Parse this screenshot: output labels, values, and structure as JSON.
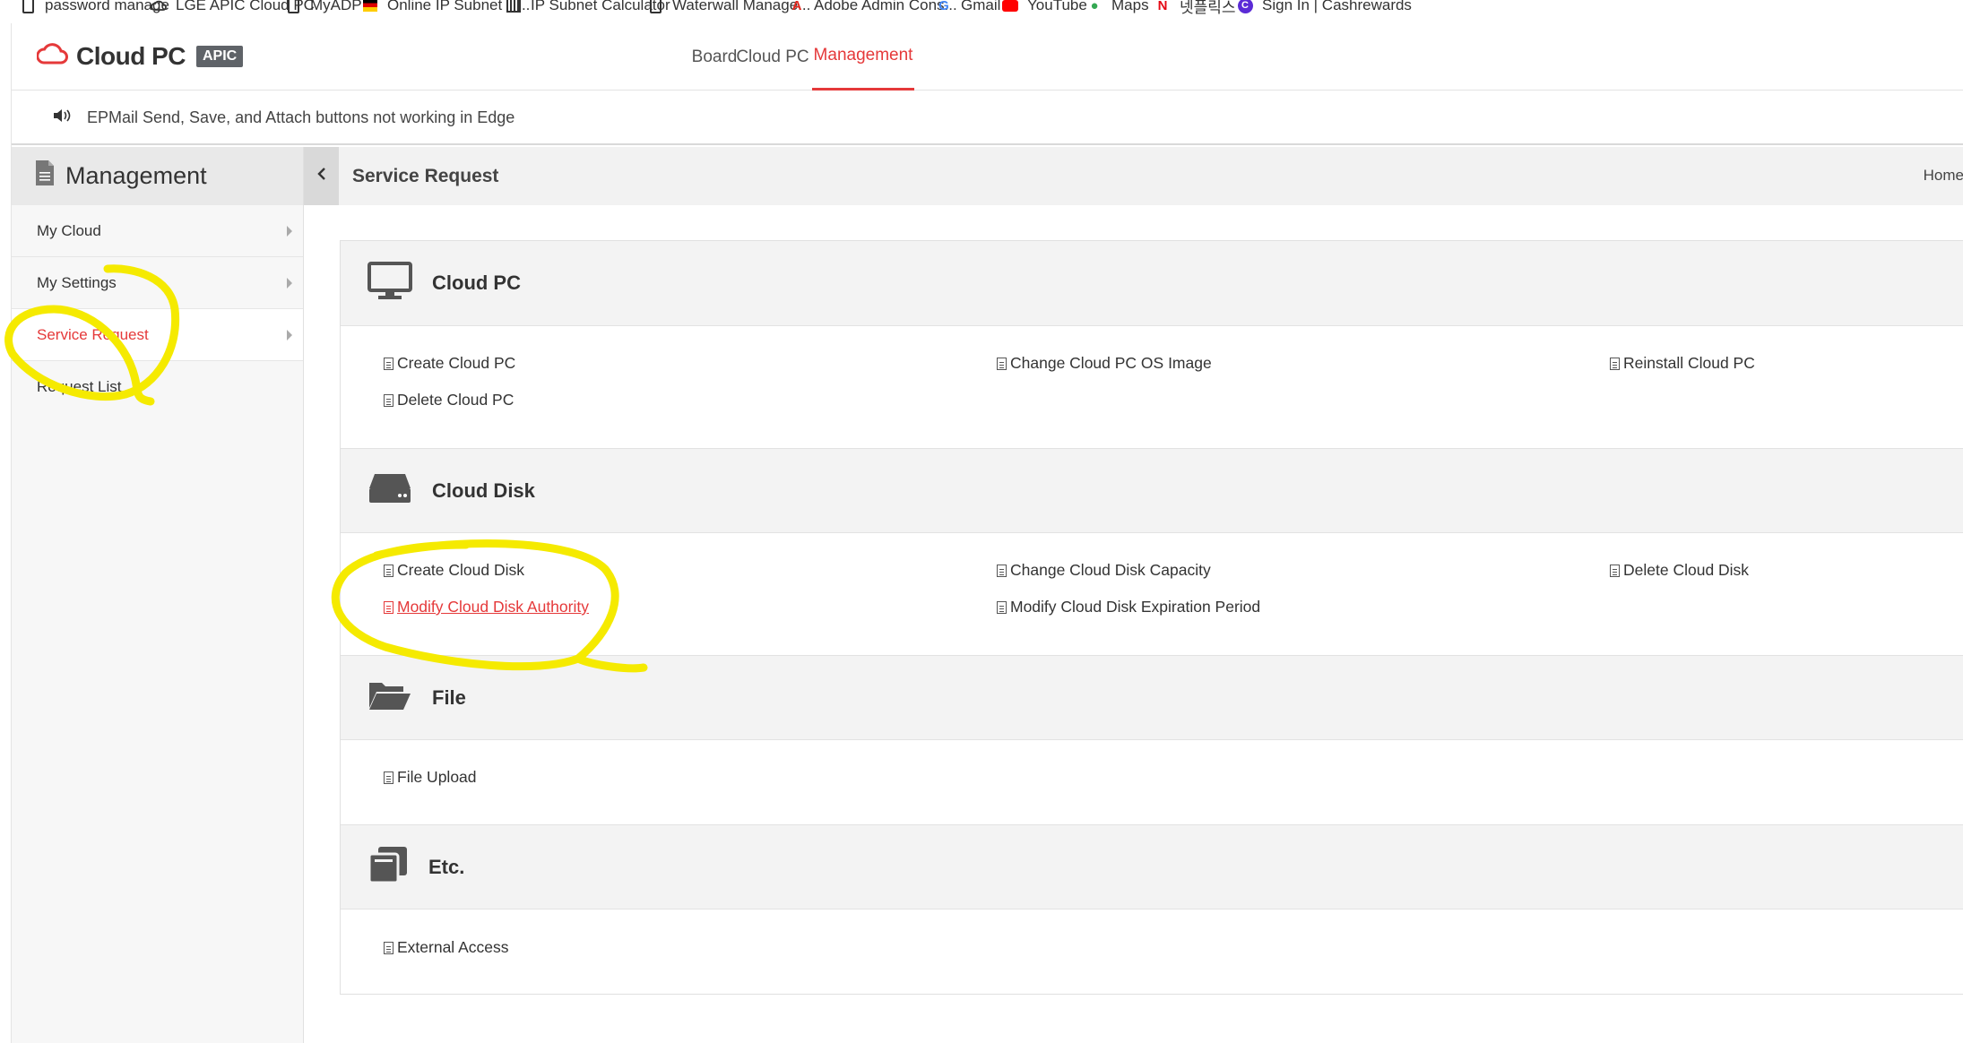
{
  "bookmarks": [
    {
      "label": "password manage",
      "icon": "page-icon"
    },
    {
      "label": "LGE APIC Cloud PC",
      "icon": "cloud-icon"
    },
    {
      "label": "MyADP",
      "icon": "page-icon"
    },
    {
      "label": "Online IP Subnet C...",
      "icon": "flag-icon"
    },
    {
      "label": "IP Subnet Calculator",
      "icon": "calculator-icon"
    },
    {
      "label": "Waterwall Manage...",
      "icon": "page-icon"
    },
    {
      "label": "Adobe Admin Cons...",
      "icon": "adobe-icon"
    },
    {
      "label": "Gmail",
      "icon": "google-icon"
    },
    {
      "label": "YouTube",
      "icon": "youtube-icon"
    },
    {
      "label": "Maps",
      "icon": "maps-icon"
    },
    {
      "label": "넷플릭스",
      "icon": "netflix-icon"
    },
    {
      "label": "Sign In | Cashrewards",
      "icon": "cashrewards-icon"
    }
  ],
  "header": {
    "logo_text": "Cloud PC",
    "logo_badge": "APIC",
    "tabs": [
      {
        "label": "Board"
      },
      {
        "label": "Cloud PC"
      },
      {
        "label": "Management",
        "active": true
      }
    ]
  },
  "notice": {
    "text": "EPMail Send, Save, and Attach buttons not working in Edge"
  },
  "sidebar": {
    "title": "Management",
    "items": [
      {
        "label": "My Cloud"
      },
      {
        "label": "My Settings"
      },
      {
        "label": "Service Request",
        "active": true
      },
      {
        "label": "Request List"
      }
    ]
  },
  "content": {
    "title": "Service Request",
    "breadcrumb": "Home",
    "sections": [
      {
        "title": "Cloud PC",
        "icon": "monitor-icon",
        "links": [
          "Create Cloud PC",
          "Change Cloud PC OS Image",
          "Reinstall Cloud PC",
          "Delete Cloud PC"
        ]
      },
      {
        "title": "Cloud Disk",
        "icon": "hard-drive-icon",
        "links": [
          "Create Cloud Disk",
          "Change Cloud Disk Capacity",
          "Delete Cloud Disk",
          "Modify Cloud Disk Authority",
          "Modify Cloud Disk Expiration Period"
        ]
      },
      {
        "title": "File",
        "icon": "folder-open-icon",
        "links": [
          "File Upload"
        ]
      },
      {
        "title": "Etc.",
        "icon": "copy-icon",
        "links": [
          "External Access"
        ]
      }
    ]
  },
  "colors": {
    "accent": "#e5393a",
    "highlighter": "#f5ea00"
  }
}
